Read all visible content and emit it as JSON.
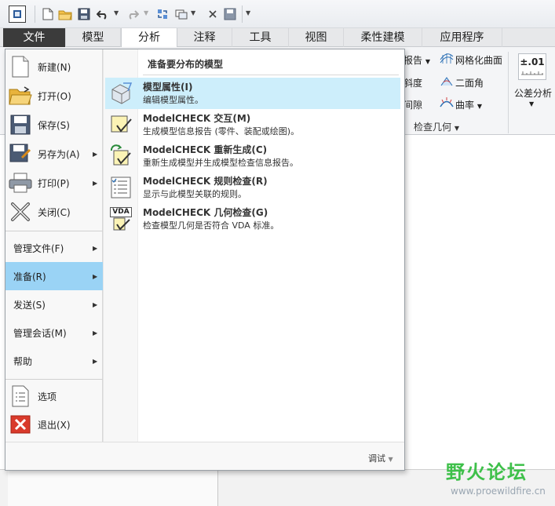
{
  "tabs": {
    "file": "文件",
    "model": "模型",
    "analysis": "分析",
    "annotate": "注释",
    "tools": "工具",
    "view": "视图",
    "flexible": "柔性建模",
    "apps": "应用程序"
  },
  "ribbon": {
    "report": "报告",
    "mesh_surface": "网格化曲面",
    "draft": "斜度",
    "dihedral": "二面角",
    "clearance": "间隙",
    "curvature": "曲率",
    "group_label": "检查几何",
    "tolerance_label": "公差分析",
    "tolerance_icon_text": "±.01"
  },
  "file_menu": {
    "new": "新建(N)",
    "open": "打开(O)",
    "save": "保存(S)",
    "save_as": "另存为(A)",
    "print": "打印(P)",
    "close": "关闭(C)",
    "manage_file": "管理文件(F)",
    "prepare": "准备(R)",
    "send": "发送(S)",
    "manage_session": "管理会话(M)",
    "help": "帮助",
    "options": "选项",
    "exit": "退出(X)",
    "debug": "调试"
  },
  "submenu": {
    "header": "准备要分布的模型",
    "items": [
      {
        "title": "模型属性(I)",
        "desc": "编辑模型属性。"
      },
      {
        "title": "ModelCHECK 交互(M)",
        "desc": "生成模型信息报告 (零件、装配或绘图)。"
      },
      {
        "title": "ModelCHECK 重新生成(C)",
        "desc": "重新生成模型并生成模型检查信息报告。"
      },
      {
        "title": "ModelCHECK 规则检查(R)",
        "desc": "显示与此模型关联的规则。"
      },
      {
        "title": "ModelCHECK 几何检查(G)",
        "desc": "检查模型几何是否符合 VDA 标准。"
      }
    ],
    "vda_text": "VDA"
  },
  "watermark": {
    "logo": "野火论坛",
    "url": "www.proewildfire.cn"
  },
  "colors": {
    "selected": "#9ad3f5",
    "highlight": "#cdeefb",
    "file_tab": "#3b3b3b",
    "watermark": "#3ec04a"
  }
}
